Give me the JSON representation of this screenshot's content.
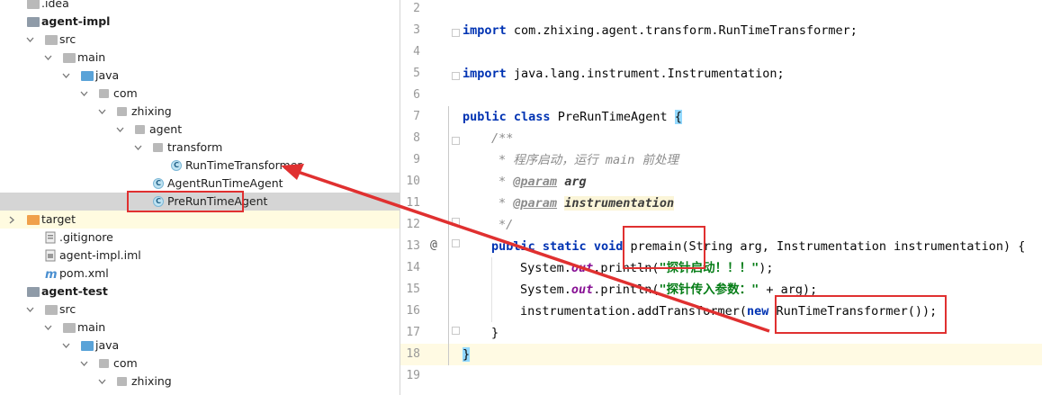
{
  "project_tree": {
    "rows": [
      {
        "label": ".idea",
        "depth": 0,
        "arrow": "none",
        "icon": "folder-gray",
        "bold": false
      },
      {
        "label": "agent-impl",
        "depth": 0,
        "arrow": "none",
        "icon": "folder-module",
        "bold": true
      },
      {
        "label": "src",
        "depth": 1,
        "arrow": "down",
        "icon": "folder-gray",
        "bold": false
      },
      {
        "label": "main",
        "depth": 2,
        "arrow": "down",
        "icon": "folder-gray",
        "bold": false
      },
      {
        "label": "java",
        "depth": 3,
        "arrow": "down",
        "icon": "folder-blue",
        "bold": false
      },
      {
        "label": "com",
        "depth": 4,
        "arrow": "down",
        "icon": "package",
        "bold": false
      },
      {
        "label": "zhixing",
        "depth": 5,
        "arrow": "down",
        "icon": "package",
        "bold": false
      },
      {
        "label": "agent",
        "depth": 6,
        "arrow": "down",
        "icon": "package",
        "bold": false
      },
      {
        "label": "transform",
        "depth": 7,
        "arrow": "down",
        "icon": "package",
        "bold": false
      },
      {
        "label": "RunTimeTransformer",
        "depth": 8,
        "arrow": "none",
        "icon": "class",
        "bold": false
      },
      {
        "label": "AgentRunTimeAgent",
        "depth": 7,
        "arrow": "none",
        "icon": "class",
        "bold": false
      },
      {
        "label": "PreRunTimeAgent",
        "depth": 7,
        "arrow": "none",
        "icon": "class",
        "bold": false,
        "selected": true
      },
      {
        "label": "target",
        "depth": 0,
        "arrow": "right",
        "icon": "folder-orange",
        "bold": false,
        "ignored": true
      },
      {
        "label": ".gitignore",
        "depth": 1,
        "arrow": "none",
        "icon": "file-git",
        "bold": false
      },
      {
        "label": "agent-impl.iml",
        "depth": 1,
        "arrow": "none",
        "icon": "file-iml",
        "bold": false
      },
      {
        "label": "pom.xml",
        "depth": 1,
        "arrow": "none",
        "icon": "maven",
        "bold": false
      },
      {
        "label": "agent-test",
        "depth": 0,
        "arrow": "none",
        "icon": "folder-module",
        "bold": true
      },
      {
        "label": "src",
        "depth": 1,
        "arrow": "down",
        "icon": "folder-gray",
        "bold": false
      },
      {
        "label": "main",
        "depth": 2,
        "arrow": "down",
        "icon": "folder-gray",
        "bold": false
      },
      {
        "label": "java",
        "depth": 3,
        "arrow": "down",
        "icon": "folder-blue",
        "bold": false
      },
      {
        "label": "com",
        "depth": 4,
        "arrow": "down",
        "icon": "package",
        "bold": false
      },
      {
        "label": "zhixing",
        "depth": 5,
        "arrow": "down",
        "icon": "package",
        "bold": false
      }
    ]
  },
  "editor": {
    "line_numbers": [
      "2",
      "3",
      "4",
      "5",
      "6",
      "7",
      "8",
      "9",
      "10",
      "11",
      "12",
      "13",
      "14",
      "15",
      "16",
      "17",
      "18",
      "19"
    ],
    "import1": {
      "kw": "import",
      "rest": " com.zhixing.agent.transform.RunTimeTransformer;"
    },
    "import2": {
      "kw": "import",
      "rest": " java.lang.instrument.Instrumentation;"
    },
    "class_decl": {
      "kw1": "public",
      "kw2": "class",
      "name": " PreRunTimeAgent ",
      "brace": "{"
    },
    "doc_open": "/**",
    "doc_line1": "* 程序启动，运行 main 前处理",
    "doc_param1_tag": "@param",
    "doc_param1_name": "arg",
    "doc_param2_tag": "@param",
    "doc_param2_name": "instrumentation",
    "doc_close": "*/",
    "method_kw1": "public",
    "method_kw2": "static",
    "method_kw3": "void",
    "method_sig": " premain(String arg, Instrumentation instrumentation) {",
    "print1_prefix": "System.",
    "print1_field": "out",
    "print1_call": ".println(",
    "print1_string": "\"探针启动！！！\"",
    "print1_end": ");",
    "print2_prefix": "System.",
    "print2_field": "out",
    "print2_call": ".println(",
    "print2_string": "\"探针传入参数：\"",
    "print2_end": " + arg);",
    "add_transformer_prefix": "instrumentation.addTransformer(",
    "add_transformer_kw": "new",
    "add_transformer_rest": " RunTimeTransformer());",
    "method_close": "}",
    "class_close": "}",
    "annotation_gutter_icon": "@"
  },
  "colors": {
    "keyword": "#0033b3",
    "string": "#067d17",
    "comment": "#8c8c8c",
    "field": "#871094",
    "annotation_red": "#e03030",
    "selection": "#d5d5d5"
  }
}
